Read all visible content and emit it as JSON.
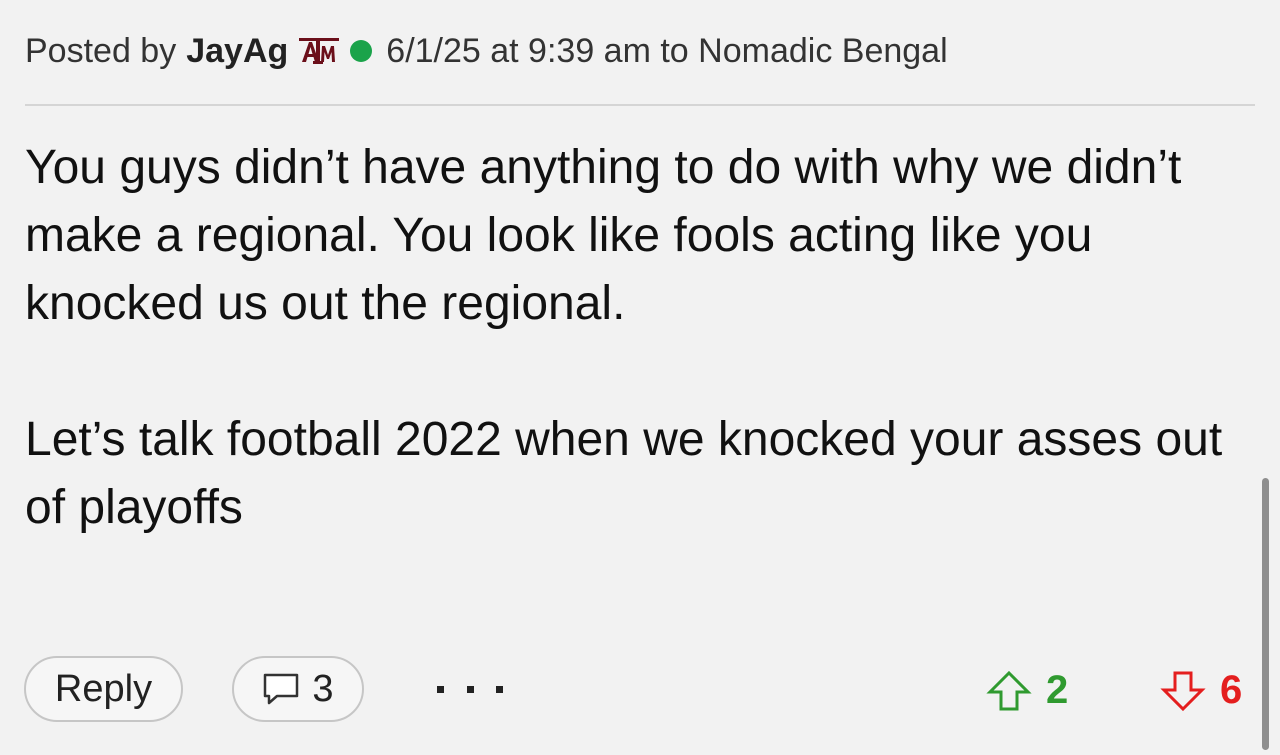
{
  "post": {
    "prefix": "Posted by",
    "username": "JayAg",
    "team_logo_text": "ATM",
    "timestamp": "6/1/25 at 9:39 am to Nomadic Bengal",
    "paragraph1": "You guys didn’t have anything to do with why we didn’t make a regional. You look like fools acting like you knocked us out the regional.",
    "paragraph2": "Let’s talk football 2022 when we knocked your asses out of playoffs"
  },
  "actions": {
    "reply_label": "Reply",
    "comment_count": "3",
    "upvotes": "2",
    "downvotes": "6"
  },
  "colors": {
    "online": "#1aa34a",
    "upvote": "#2f9a2f",
    "downvote": "#e41e1e",
    "logo": "#6b0f1a"
  },
  "icons": [
    "team-logo-icon",
    "online-status-icon",
    "comment-icon",
    "more-icon",
    "upvote-icon",
    "downvote-icon"
  ]
}
